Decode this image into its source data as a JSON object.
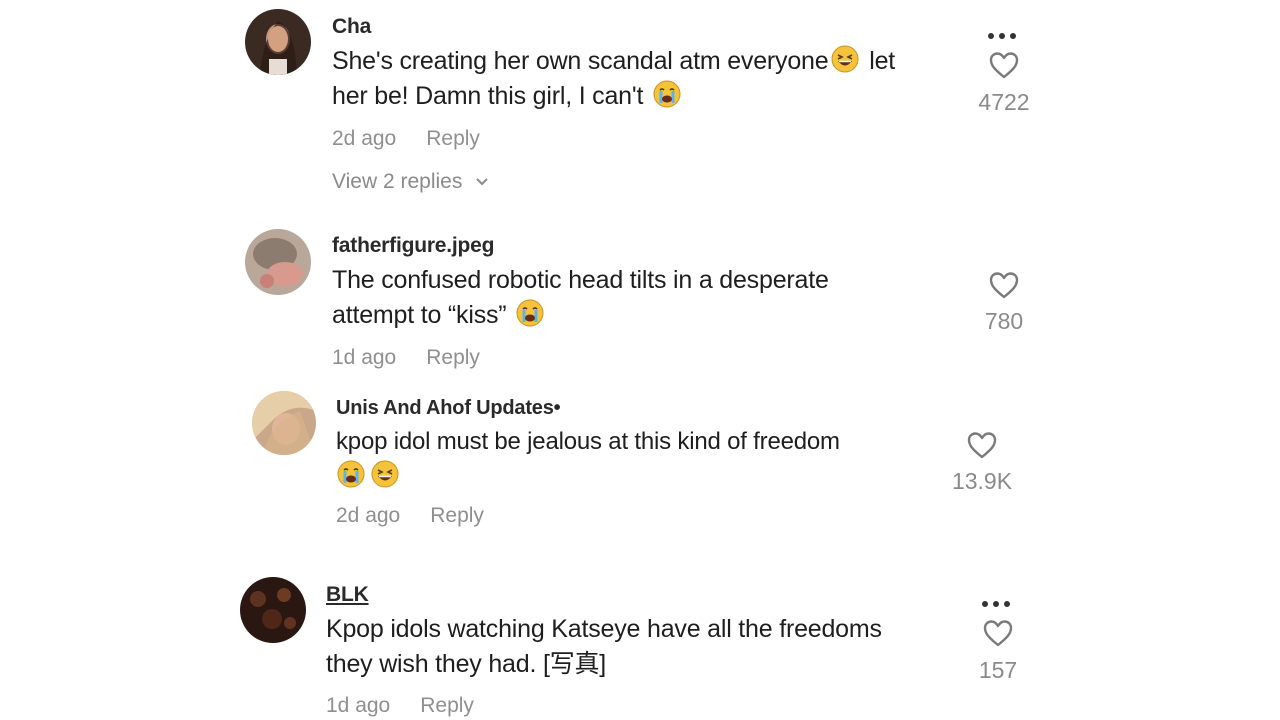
{
  "comments": [
    {
      "username": "Cha",
      "text_before_emoji": "She's creating her own scandal atm everyone",
      "text_after_emoji": " let",
      "line2": "her be! Damn this girl, I can't",
      "time": "2d ago",
      "reply_label": "Reply",
      "likes": "4722",
      "view_replies": "View 2 replies",
      "emojis": [
        "grinning-sweat-emoji",
        "loudly-crying-emoji"
      ]
    },
    {
      "username": "fatherfigure.jpeg",
      "line1": "The confused robotic head tilts in a desperate",
      "line2": "attempt to “kiss”",
      "time": "1d ago",
      "reply_label": "Reply",
      "likes": "780",
      "emojis": [
        "loudly-crying-emoji"
      ]
    },
    {
      "username": "Unis And Ahof Updates•",
      "line1": "kpop idol must be jealous at this kind of freedom",
      "time": "2d ago",
      "reply_label": "Reply",
      "likes": "13.9K",
      "emojis": [
        "loudly-crying-emoji",
        "grinning-sweat-emoji"
      ]
    },
    {
      "username": "BLK",
      "line1": "Kpop idols watching Katseye have all the freedoms",
      "line2": "they wish they had. [写真]",
      "time": "1d ago",
      "reply_label": "Reply",
      "likes": "157"
    }
  ],
  "colors": {
    "text": "#1e1e1e",
    "muted": "#8f8f8f",
    "emoji_yellow": "#f5c33b"
  }
}
